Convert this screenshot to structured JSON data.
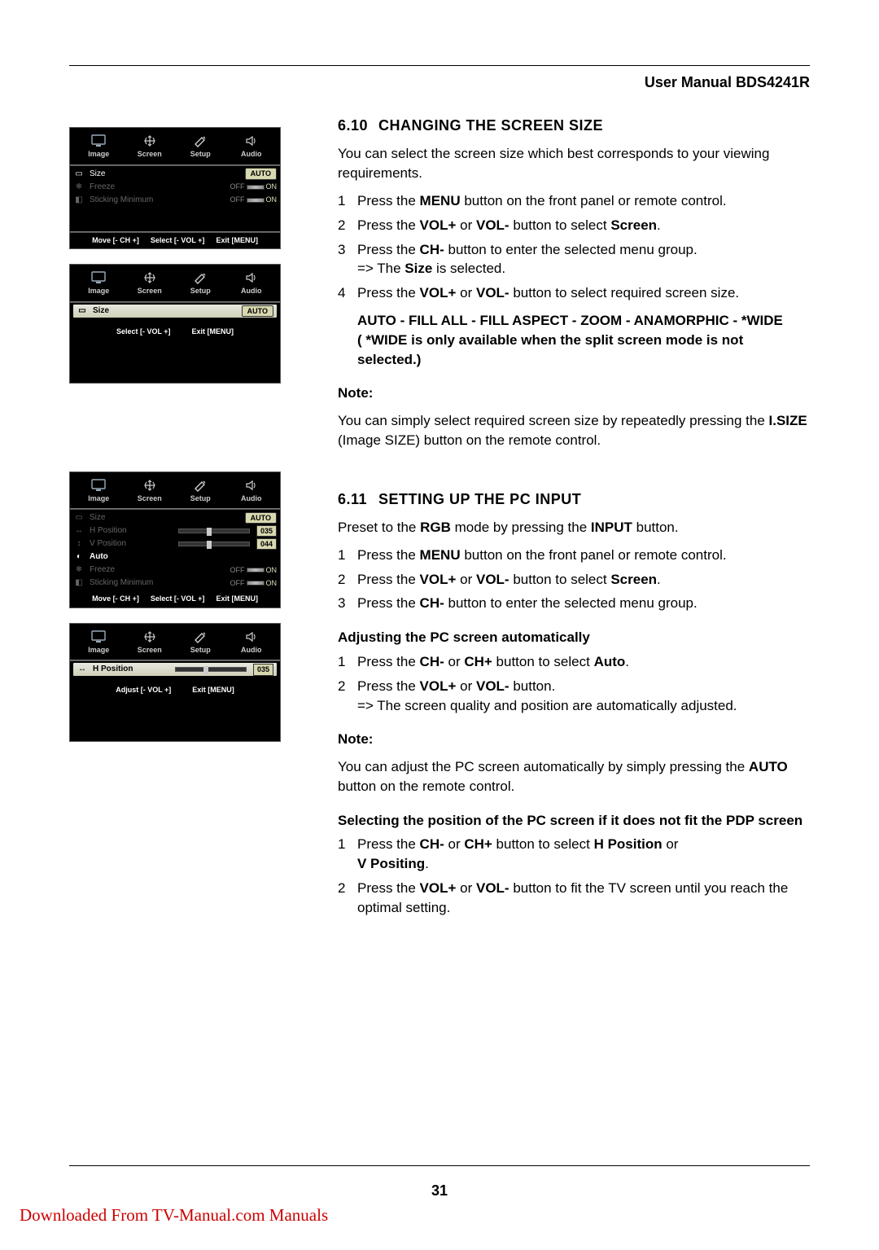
{
  "header": {
    "manual_title": "User Manual BDS4241R"
  },
  "section_610": {
    "num": "6.10",
    "title": "CHANGING THE SCREEN SIZE",
    "intro": "You can select the screen size which best corresponds to your viewing requirements.",
    "steps": {
      "1_a": "Press the ",
      "1_b": "MENU",
      "1_c": " button on the front panel or remote control.",
      "2_a": "Press the ",
      "2_b": "VOL+",
      "2_c": " or ",
      "2_d": "VOL-",
      "2_e": " button to select ",
      "2_f": "Screen",
      "2_g": ".",
      "3_a": "Press the ",
      "3_b": "CH-",
      "3_c": " button to enter the selected menu group.",
      "3_res_a": "=> The ",
      "3_res_b": "Size",
      "3_res_c": " is selected.",
      "4_a": "Press the ",
      "4_b": "VOL+",
      "4_c": " or ",
      "4_d": "VOL-",
      "4_e": " button to select required screen size."
    },
    "modes": "AUTO - FILL ALL - FILL ASPECT - ZOOM - ANAMORPHIC - *WIDE",
    "wide_note": "( *WIDE is only available when the split screen mode is not selected.)",
    "note_label": "Note:",
    "note_a": "You can simply select required screen size by repeatedly pressing the ",
    "note_b": "I.SIZE",
    "note_c": " (Image SIZE) button on the remote control."
  },
  "section_611": {
    "num": "6.11",
    "title": "SETTING UP THE PC INPUT",
    "preset_a": "Preset to the ",
    "preset_b": "RGB",
    "preset_c": " mode by pressing the ",
    "preset_d": "INPUT",
    "preset_e": " button.",
    "steps": {
      "1_a": "Press the ",
      "1_b": "MENU",
      "1_c": " button on the front panel or remote control.",
      "2_a": "Press the ",
      "2_b": "VOL+",
      "2_c": " or ",
      "2_d": "VOL-",
      "2_e": " button to select ",
      "2_f": "Screen",
      "2_g": ".",
      "3_a": "Press the ",
      "3_b": "CH-",
      "3_c": " button to enter the selected menu group."
    },
    "auto_head": "Adjusting the PC screen automatically",
    "auto_steps": {
      "1_a": "Press the ",
      "1_b": "CH-",
      "1_c": " or ",
      "1_d": "CH+",
      "1_e": " button to select ",
      "1_f": "Auto",
      "1_g": ".",
      "2_a": "Press the ",
      "2_b": "VOL+",
      "2_c": " or ",
      "2_d": "VOL-",
      "2_e": " button.",
      "2_res": "=> The screen quality and position are automatically adjusted."
    },
    "note_label": "Note:",
    "note_a": "You can adjust the PC screen automatically by simply pressing the ",
    "note_b": "AUTO",
    "note_c": " button on the remote control.",
    "pos_head": "Selecting the position of the PC screen if it does not fit the PDP screen",
    "pos_steps": {
      "1_a": "Press the ",
      "1_b": "CH-",
      "1_c": " or ",
      "1_d": "CH+",
      "1_e": " button to select ",
      "1_f": "H Position",
      "1_g": " or ",
      "1_h": "V Positing",
      "1_i": ".",
      "2_a": "Press the ",
      "2_b": "VOL+",
      "2_c": " or ",
      "2_d": "VOL-",
      "2_e": " button to fit the TV screen until you reach the optimal setting."
    }
  },
  "osd_common": {
    "tab_image": "Image",
    "tab_screen": "Screen",
    "tab_setup": "Setup",
    "tab_audio": "Audio",
    "hint_move": "Move [- CH +]",
    "hint_select": "Select [- VOL +]",
    "hint_adjust": "Adjust [- VOL +]",
    "hint_exit": "Exit [MENU]",
    "off": "OFF",
    "on": "ON"
  },
  "osd1": {
    "size": "Size",
    "size_val": "AUTO",
    "freeze": "Freeze",
    "sticking": "Sticking Minimum"
  },
  "osd2": {
    "size": "Size",
    "size_val": "AUTO"
  },
  "osd3": {
    "size": "Size",
    "size_val": "AUTO",
    "hpos": "H Position",
    "hpos_val": "035",
    "vpos": "V Position",
    "vpos_val": "044",
    "auto": "Auto",
    "freeze": "Freeze",
    "sticking": "Sticking Minimum"
  },
  "osd4": {
    "hpos": "H Position",
    "hpos_val": "035"
  },
  "page_number": "31",
  "download_link": "Downloaded From TV-Manual.com Manuals"
}
